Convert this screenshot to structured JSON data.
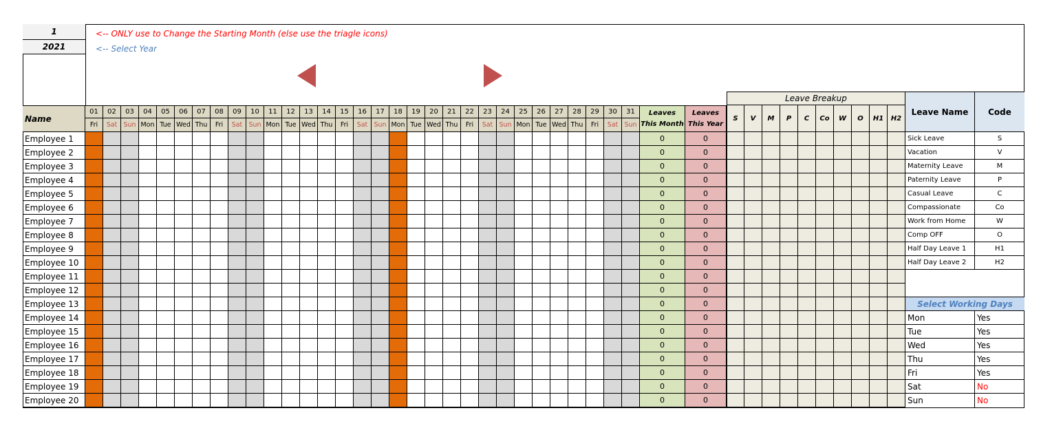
{
  "controls": {
    "month_value": "1",
    "year_value": "2021",
    "month_hint": "<-- ONLY use to Change the Starting Month (else use the triagle icons)",
    "year_hint": "<-- Select Year",
    "prev_icon": "triangle-left-icon",
    "next_icon": "triangle-right-icon"
  },
  "colors": {
    "accent_red": "#ff0000",
    "hint_blue": "#4f81bd",
    "holiday_orange": "#e36c09",
    "weekend_grey": "#d9d9d9",
    "month_green": "#d8e4bc",
    "year_pink": "#e6b8b7",
    "triangle": "#c0504d"
  },
  "grid": {
    "name_header": "Name",
    "days": [
      {
        "num": "01",
        "dow": "Fri",
        "type": "holiday"
      },
      {
        "num": "02",
        "dow": "Sat",
        "type": "weekend"
      },
      {
        "num": "03",
        "dow": "Sun",
        "type": "weekend"
      },
      {
        "num": "04",
        "dow": "Mon",
        "type": "work"
      },
      {
        "num": "05",
        "dow": "Tue",
        "type": "work"
      },
      {
        "num": "06",
        "dow": "Wed",
        "type": "work"
      },
      {
        "num": "07",
        "dow": "Thu",
        "type": "work"
      },
      {
        "num": "08",
        "dow": "Fri",
        "type": "work"
      },
      {
        "num": "09",
        "dow": "Sat",
        "type": "weekend"
      },
      {
        "num": "10",
        "dow": "Sun",
        "type": "weekend"
      },
      {
        "num": "11",
        "dow": "Mon",
        "type": "work"
      },
      {
        "num": "12",
        "dow": "Tue",
        "type": "work"
      },
      {
        "num": "13",
        "dow": "Wed",
        "type": "work"
      },
      {
        "num": "14",
        "dow": "Thu",
        "type": "work"
      },
      {
        "num": "15",
        "dow": "Fri",
        "type": "work"
      },
      {
        "num": "16",
        "dow": "Sat",
        "type": "weekend"
      },
      {
        "num": "17",
        "dow": "Sun",
        "type": "weekend"
      },
      {
        "num": "18",
        "dow": "Mon",
        "type": "holiday"
      },
      {
        "num": "19",
        "dow": "Tue",
        "type": "work"
      },
      {
        "num": "20",
        "dow": "Wed",
        "type": "work"
      },
      {
        "num": "21",
        "dow": "Thu",
        "type": "work"
      },
      {
        "num": "22",
        "dow": "Fri",
        "type": "work"
      },
      {
        "num": "23",
        "dow": "Sat",
        "type": "weekend"
      },
      {
        "num": "24",
        "dow": "Sun",
        "type": "weekend"
      },
      {
        "num": "25",
        "dow": "Mon",
        "type": "work"
      },
      {
        "num": "26",
        "dow": "Tue",
        "type": "work"
      },
      {
        "num": "27",
        "dow": "Wed",
        "type": "work"
      },
      {
        "num": "28",
        "dow": "Thu",
        "type": "work"
      },
      {
        "num": "29",
        "dow": "Fri",
        "type": "work"
      },
      {
        "num": "30",
        "dow": "Sat",
        "type": "weekend"
      },
      {
        "num": "31",
        "dow": "Sun",
        "type": "weekend"
      }
    ],
    "leaves_month_header": "Leaves This Month",
    "leaves_year_header": "Leaves This Year",
    "breakup_header": "Leave Breakup",
    "breakup_codes": [
      "S",
      "V",
      "M",
      "P",
      "C",
      "Co",
      "W",
      "O",
      "H1",
      "H2"
    ],
    "employees": [
      {
        "name": "Employee 1",
        "month": "0",
        "year": "0"
      },
      {
        "name": "Employee 2",
        "month": "0",
        "year": "0"
      },
      {
        "name": "Employee 3",
        "month": "0",
        "year": "0"
      },
      {
        "name": "Employee 4",
        "month": "0",
        "year": "0"
      },
      {
        "name": "Employee 5",
        "month": "0",
        "year": "0"
      },
      {
        "name": "Employee 6",
        "month": "0",
        "year": "0"
      },
      {
        "name": "Employee 7",
        "month": "0",
        "year": "0"
      },
      {
        "name": "Employee 8",
        "month": "0",
        "year": "0"
      },
      {
        "name": "Employee 9",
        "month": "0",
        "year": "0"
      },
      {
        "name": "Employee 10",
        "month": "0",
        "year": "0"
      },
      {
        "name": "Employee 11",
        "month": "0",
        "year": "0"
      },
      {
        "name": "Employee 12",
        "month": "0",
        "year": "0"
      },
      {
        "name": "Employee 13",
        "month": "0",
        "year": "0"
      },
      {
        "name": "Employee 14",
        "month": "0",
        "year": "0"
      },
      {
        "name": "Employee 15",
        "month": "0",
        "year": "0"
      },
      {
        "name": "Employee 16",
        "month": "0",
        "year": "0"
      },
      {
        "name": "Employee 17",
        "month": "0",
        "year": "0"
      },
      {
        "name": "Employee 18",
        "month": "0",
        "year": "0"
      },
      {
        "name": "Employee 19",
        "month": "0",
        "year": "0"
      },
      {
        "name": "Employee 20",
        "month": "0",
        "year": "0"
      }
    ]
  },
  "legend": {
    "name_header": "Leave Name",
    "code_header": "Code",
    "items": [
      {
        "name": "Sick Leave",
        "code": "S"
      },
      {
        "name": "Vacation",
        "code": "V"
      },
      {
        "name": "Maternity Leave",
        "code": "M"
      },
      {
        "name": "Paternity Leave",
        "code": "P"
      },
      {
        "name": "Casual Leave",
        "code": "C"
      },
      {
        "name": "Compassionate",
        "code": "Co"
      },
      {
        "name": "Work from Home",
        "code": "W"
      },
      {
        "name": "Comp OFF",
        "code": "O"
      },
      {
        "name": "Half Day Leave 1",
        "code": "H1"
      },
      {
        "name": "Half Day Leave 2",
        "code": "H2"
      }
    ]
  },
  "working_days": {
    "header": "Select Working Days",
    "items": [
      {
        "day": "Mon",
        "value": "Yes"
      },
      {
        "day": "Tue",
        "value": "Yes"
      },
      {
        "day": "Wed",
        "value": "Yes"
      },
      {
        "day": "Thu",
        "value": "Yes"
      },
      {
        "day": "Fri",
        "value": "Yes"
      },
      {
        "day": "Sat",
        "value": "No"
      },
      {
        "day": "Sun",
        "value": "No"
      }
    ]
  }
}
